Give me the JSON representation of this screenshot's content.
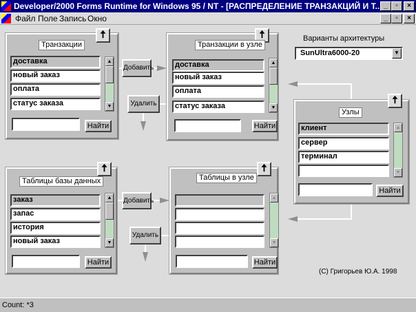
{
  "window": {
    "title": "Developer/2000 Forms Runtime for Windows 95 / NT - [РАСПРЕДЕЛЕНИЕ  ТРАНЗАКЦИЙ  И  Т...",
    "min": "_",
    "max": "▫",
    "close": "×"
  },
  "menu": [
    {
      "label": "Файл"
    },
    {
      "label": "Поле"
    },
    {
      "label": "Запись"
    },
    {
      "label": "Окно"
    }
  ],
  "transactions": {
    "title": "Транзакции",
    "rows": [
      "доставка",
      "новый заказ",
      "оплата",
      "статус заказа"
    ],
    "find": "Найти"
  },
  "node_transactions": {
    "title": "Транзакции в узле",
    "rows": [
      "доставка",
      "новый заказ",
      "оплата",
      "статус заказа"
    ],
    "find": "Найти"
  },
  "nodes": {
    "title": "Узлы",
    "rows": [
      "клиент",
      "сервер",
      "терминал",
      ""
    ],
    "find": "Найти"
  },
  "db_tables": {
    "title": "Таблицы базы данных",
    "rows": [
      "заказ",
      "запас",
      "история",
      "новый заказ"
    ],
    "find": "Найти"
  },
  "node_tables": {
    "title": "Таблицы в узле",
    "rows": [
      "",
      "",
      "",
      "",
      ""
    ],
    "find": "Найти"
  },
  "actions": {
    "add": "Добавить",
    "remove": "Удалить",
    "up": "🠅"
  },
  "architecture": {
    "label": "Варианты архитектуры",
    "value": "SunUltra6000-20"
  },
  "copyright": "(C) Григорьев Ю.А. 1998",
  "status": "Count: *3"
}
